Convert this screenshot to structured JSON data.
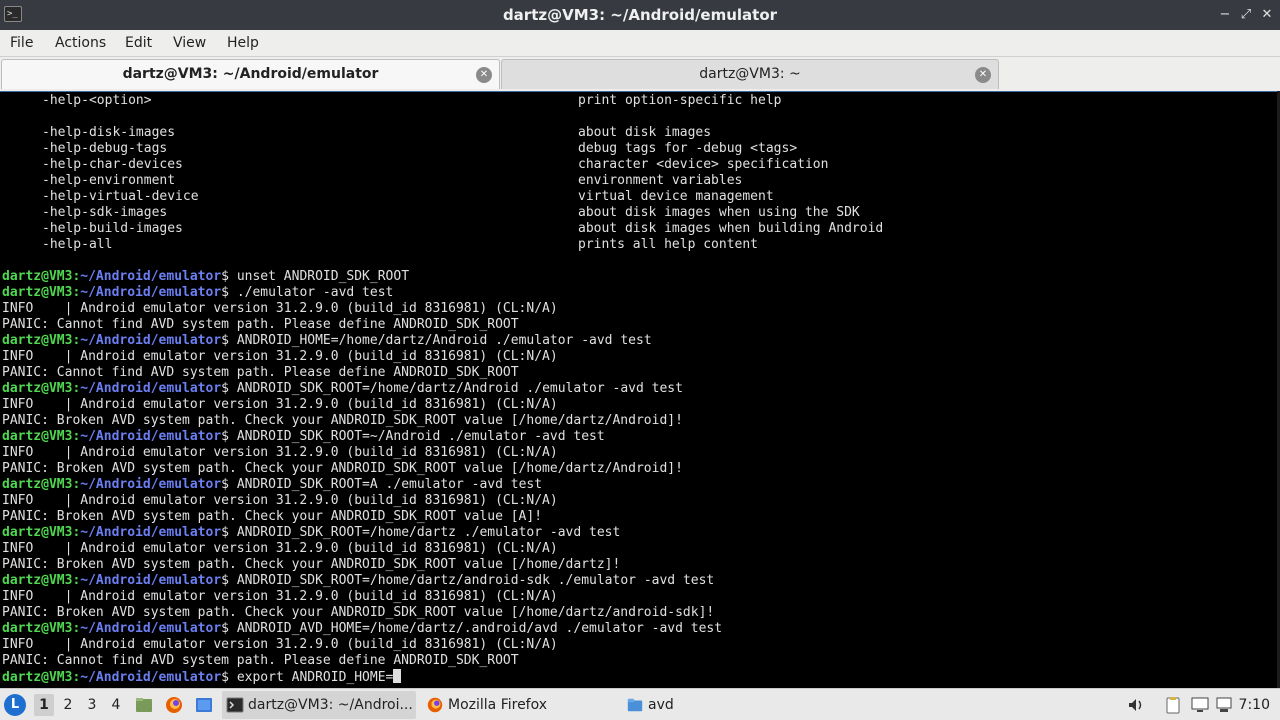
{
  "window": {
    "title": "dartz@VM3: ~/Android/emulator",
    "app_icon_glyph": ">_",
    "buttons": {
      "minimize": "−",
      "maximize": "⤢",
      "close": "✕"
    }
  },
  "menu": [
    "File",
    "Actions",
    "Edit",
    "View",
    "Help"
  ],
  "tabs": [
    {
      "label": "dartz@VM3: ~/Android/emulator",
      "active": true
    },
    {
      "label": "dartz@VM3: ~",
      "active": false
    }
  ],
  "terminal": {
    "help_lines": [
      {
        "opt": "-help-<option>",
        "desc": "print option-specific help"
      },
      {
        "opt": "",
        "desc": ""
      },
      {
        "opt": "-help-disk-images",
        "desc": "about disk images"
      },
      {
        "opt": "-help-debug-tags",
        "desc": "debug tags for -debug <tags>"
      },
      {
        "opt": "-help-char-devices",
        "desc": "character <device> specification"
      },
      {
        "opt": "-help-environment",
        "desc": "environment variables"
      },
      {
        "opt": "-help-virtual-device",
        "desc": "virtual device management"
      },
      {
        "opt": "-help-sdk-images",
        "desc": "about disk images when using the SDK"
      },
      {
        "opt": "-help-build-images",
        "desc": "about disk images when building Android"
      },
      {
        "opt": "-help-all",
        "desc": "prints all help content"
      },
      {
        "opt": "",
        "desc": ""
      }
    ],
    "prompt_user": "dartz@VM3",
    "prompt_sep": ":",
    "prompt_path": "~/Android/emulator",
    "prompt_dollar": "$ ",
    "session_lines": [
      {
        "type": "cmd",
        "text": "unset ANDROID_SDK_ROOT"
      },
      {
        "type": "cmd",
        "text": "./emulator -avd test"
      },
      {
        "type": "out",
        "text": "INFO    | Android emulator version 31.2.9.0 (build_id 8316981) (CL:N/A)"
      },
      {
        "type": "out",
        "text": "PANIC: Cannot find AVD system path. Please define ANDROID_SDK_ROOT"
      },
      {
        "type": "cmd",
        "text": "ANDROID_HOME=/home/dartz/Android ./emulator -avd test"
      },
      {
        "type": "out",
        "text": "INFO    | Android emulator version 31.2.9.0 (build_id 8316981) (CL:N/A)"
      },
      {
        "type": "out",
        "text": "PANIC: Cannot find AVD system path. Please define ANDROID_SDK_ROOT"
      },
      {
        "type": "cmd",
        "text": "ANDROID_SDK_ROOT=/home/dartz/Android ./emulator -avd test"
      },
      {
        "type": "out",
        "text": "INFO    | Android emulator version 31.2.9.0 (build_id 8316981) (CL:N/A)"
      },
      {
        "type": "out",
        "text": "PANIC: Broken AVD system path. Check your ANDROID_SDK_ROOT value [/home/dartz/Android]!"
      },
      {
        "type": "cmd",
        "text": "ANDROID_SDK_ROOT=~/Android ./emulator -avd test"
      },
      {
        "type": "out",
        "text": "INFO    | Android emulator version 31.2.9.0 (build_id 8316981) (CL:N/A)"
      },
      {
        "type": "out",
        "text": "PANIC: Broken AVD system path. Check your ANDROID_SDK_ROOT value [/home/dartz/Android]!"
      },
      {
        "type": "cmd",
        "text": "ANDROID_SDK_ROOT=A ./emulator -avd test"
      },
      {
        "type": "out",
        "text": "INFO    | Android emulator version 31.2.9.0 (build_id 8316981) (CL:N/A)"
      },
      {
        "type": "out",
        "text": "PANIC: Broken AVD system path. Check your ANDROID_SDK_ROOT value [A]!"
      },
      {
        "type": "cmd",
        "text": "ANDROID_SDK_ROOT=/home/dartz ./emulator -avd test"
      },
      {
        "type": "out",
        "text": "INFO    | Android emulator version 31.2.9.0 (build_id 8316981) (CL:N/A)"
      },
      {
        "type": "out",
        "text": "PANIC: Broken AVD system path. Check your ANDROID_SDK_ROOT value [/home/dartz]!"
      },
      {
        "type": "cmd",
        "text": "ANDROID_SDK_ROOT=/home/dartz/android-sdk ./emulator -avd test"
      },
      {
        "type": "out",
        "text": "INFO    | Android emulator version 31.2.9.0 (build_id 8316981) (CL:N/A)"
      },
      {
        "type": "out",
        "text": "PANIC: Broken AVD system path. Check your ANDROID_SDK_ROOT value [/home/dartz/android-sdk]!"
      },
      {
        "type": "cmd",
        "text": "ANDROID_AVD_HOME=/home/dartz/.android/avd ./emulator -avd test"
      },
      {
        "type": "out",
        "text": "INFO    | Android emulator version 31.2.9.0 (build_id 8316981) (CL:N/A)"
      },
      {
        "type": "out",
        "text": "PANIC: Cannot find AVD system path. Please define ANDROID_SDK_ROOT"
      },
      {
        "type": "input",
        "text": "export ANDROID_HOME="
      }
    ]
  },
  "taskbar": {
    "workspaces": [
      "1",
      "2",
      "3",
      "4"
    ],
    "active_workspace": "1",
    "quick_launch": [
      "file-manager-icon",
      "firefox-icon",
      "desktop-icon"
    ],
    "tasks": [
      {
        "label": "dartz@VM3: ~/Androi...",
        "icon": "terminal-icon",
        "active": true
      },
      {
        "label": "Mozilla Firefox",
        "icon": "firefox-icon",
        "active": false
      },
      {
        "label": "avd",
        "icon": "folder-icon",
        "active": false
      }
    ],
    "tray": [
      "volume-icon",
      "clipboard-icon",
      "display-icon",
      "network-icon"
    ],
    "clock": "7:10"
  },
  "colors": {
    "prompt_user": "#4fd84f",
    "prompt_path": "#6b7ff2",
    "terminal_bg": "#000000",
    "terminal_fg": "#e0e0e0"
  }
}
